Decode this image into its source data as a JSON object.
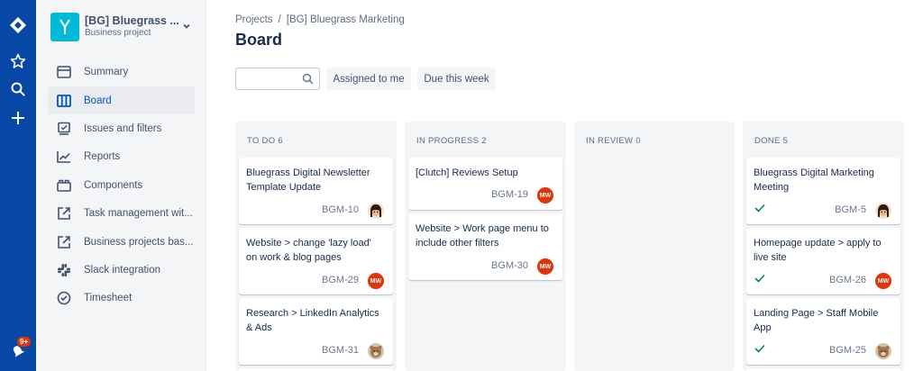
{
  "global_nav": {
    "notifications_badge": "9+"
  },
  "project": {
    "name": "[BG] Bluegrass ...",
    "type": "Business project"
  },
  "sidebar": {
    "items": [
      {
        "label": "Summary",
        "icon": "summary-icon"
      },
      {
        "label": "Board",
        "icon": "board-icon",
        "active": true
      },
      {
        "label": "Issues and filters",
        "icon": "issues-icon"
      },
      {
        "label": "Reports",
        "icon": "reports-icon"
      },
      {
        "label": "Components",
        "icon": "components-icon"
      },
      {
        "label": "Task management wit...",
        "icon": "external-link-icon"
      },
      {
        "label": "Business projects bas...",
        "icon": "external-link-icon"
      },
      {
        "label": "Slack integration",
        "icon": "slack-icon"
      },
      {
        "label": "Timesheet",
        "icon": "timesheet-icon"
      }
    ]
  },
  "breadcrumb": {
    "root": "Projects",
    "separator": "/",
    "current": "[BG] Bluegrass Marketing"
  },
  "page": {
    "title": "Board"
  },
  "filters": {
    "search_value": "",
    "assigned_to_me": "Assigned to me",
    "due_this_week": "Due this week"
  },
  "columns": [
    {
      "header": "TO DO 6",
      "cards": [
        {
          "title": "Bluegrass Digital Newsletter Template Update",
          "key": "BGM-10",
          "avatar": "face"
        },
        {
          "title": "Website > change 'lazy load' on work & blog pages",
          "key": "BGM-29",
          "avatar": "MW"
        },
        {
          "title": "Research > LinkedIn Analytics & Ads",
          "key": "BGM-31",
          "avatar": "bear"
        }
      ]
    },
    {
      "header": "IN PROGRESS 2",
      "cards": [
        {
          "title": "[Clutch] Reviews Setup",
          "key": "BGM-19",
          "avatar": "MW"
        },
        {
          "title": "Website > Work page menu to include other filters",
          "key": "BGM-30",
          "avatar": "MW"
        }
      ]
    },
    {
      "header": "IN REVIEW 0",
      "cards": []
    },
    {
      "header": "DONE 5",
      "cards": [
        {
          "title": "Bluegrass Digital Marketing Meeting",
          "key": "BGM-5",
          "avatar": "face",
          "done": true
        },
        {
          "title": "Homepage update > apply to live site",
          "key": "BGM-26",
          "avatar": "MW",
          "done": true
        },
        {
          "title": "Landing Page > Staff Mobile App",
          "key": "BGM-25",
          "avatar": "bear",
          "done": true
        }
      ]
    }
  ],
  "colors": {
    "global_nav": "#0747a6",
    "project_avatar": "#00b8d9",
    "active_link": "#0052cc",
    "mw_avatar": "#de350b",
    "done_check": "#00875a"
  }
}
